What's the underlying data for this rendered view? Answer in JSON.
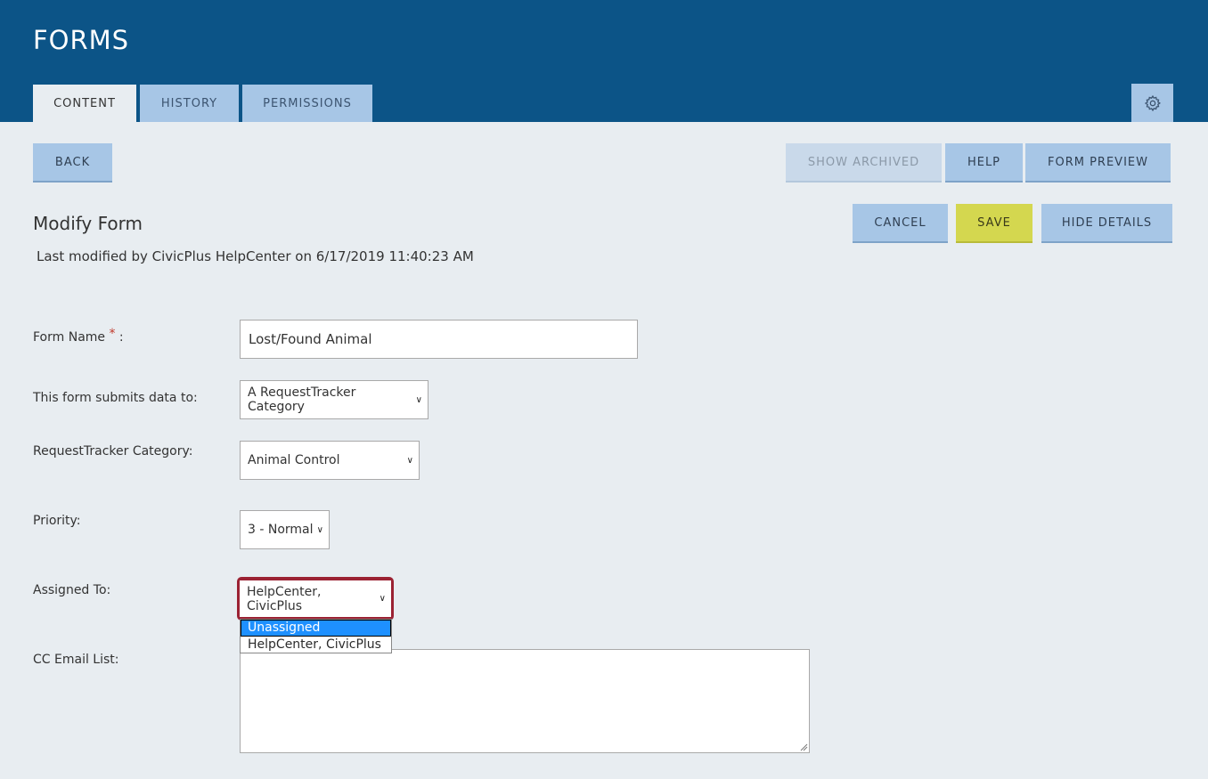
{
  "header": {
    "title": "FORMS",
    "tabs": [
      {
        "label": "CONTENT",
        "active": true
      },
      {
        "label": "HISTORY",
        "active": false
      },
      {
        "label": "PERMISSIONS",
        "active": false
      }
    ],
    "settings_icon": "gear-icon"
  },
  "toolbar": {
    "back": "BACK",
    "show_archived": "SHOW ARCHIVED",
    "help": "HELP",
    "form_preview": "FORM PREVIEW"
  },
  "form": {
    "section_title": "Modify Form",
    "last_modified": "Last modified by CivicPlus HelpCenter on 6/17/2019 11:40:23 AM",
    "actions": {
      "cancel": "CANCEL",
      "save": "SAVE",
      "hide_details": "HIDE DETAILS"
    },
    "fields": {
      "form_name": {
        "label": "Form Name",
        "required_mark": "*",
        "suffix": " :",
        "value": "Lost/Found Animal"
      },
      "submits_to": {
        "label": "This form submits data to:",
        "value": "A RequestTracker Category"
      },
      "category": {
        "label": "RequestTracker Category:",
        "value": "Animal Control"
      },
      "priority": {
        "label": "Priority:",
        "value": "3 - Normal"
      },
      "assigned_to": {
        "label": "Assigned To:",
        "value": "HelpCenter, CivicPlus",
        "options": [
          "Unassigned",
          "HelpCenter, CivicPlus"
        ],
        "highlighted_option": "Unassigned"
      },
      "cc_email": {
        "label": "CC Email List:",
        "value": ""
      }
    }
  },
  "colors": {
    "header_bg": "#0c5487",
    "button_bg": "#a7c6e6",
    "save_bg": "#d4d74f",
    "page_bg": "#e8edf1",
    "focus_ring": "#9b2233",
    "highlight": "#1e90ff"
  }
}
